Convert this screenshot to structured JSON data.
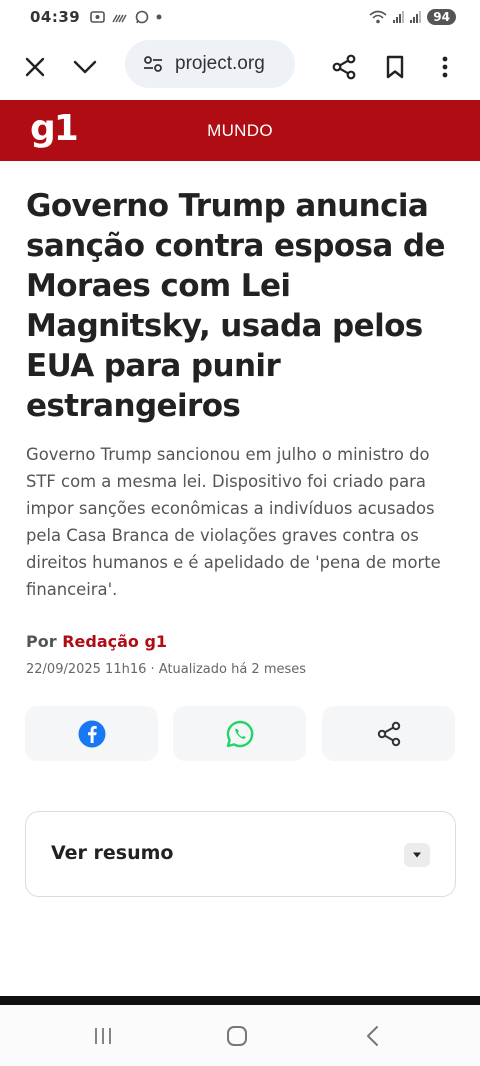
{
  "status_bar": {
    "time": "04:39",
    "battery": "94",
    "left_icons": [
      "screenshot-icon",
      "missed-call-icon",
      "whatsapp-icon",
      "dot-icon"
    ],
    "right_icons": [
      "wifi-icon",
      "signal-icon",
      "signal-icon"
    ]
  },
  "browser": {
    "url": "project.org",
    "icons": [
      "close-icon",
      "chevron-down-icon",
      "site-settings-icon",
      "share-icon",
      "bookmark-icon",
      "more-vert-icon"
    ]
  },
  "site": {
    "logo": "g1",
    "section": "MUNDO",
    "brand_color": "#b00c13"
  },
  "article": {
    "headline": "Governo Trump anuncia sanção contra esposa de Moraes com Lei Magnitsky, usada pelos EUA para punir estrangeiros",
    "subtitle": "Governo Trump sancionou em julho o ministro do STF com a mesma lei. Dispositivo foi criado para impor sanções econômicas a indivíduos acusados pela Casa Branca de violações graves contra os direitos humanos e é apelidado de 'pena de morte financeira'.",
    "byline_prefix": "Por",
    "author": "Redação g1",
    "dateline": "22/09/2025 11h16 · Atualizado há 2 meses"
  },
  "share": {
    "buttons": [
      "facebook-icon",
      "whatsapp-icon",
      "share-icon"
    ],
    "colors": {
      "facebook": "#1877f2",
      "whatsapp": "#25d366"
    }
  },
  "summary": {
    "label": "Ver resumo"
  },
  "nav": {
    "buttons": [
      "recents-icon",
      "home-icon",
      "back-icon"
    ]
  }
}
